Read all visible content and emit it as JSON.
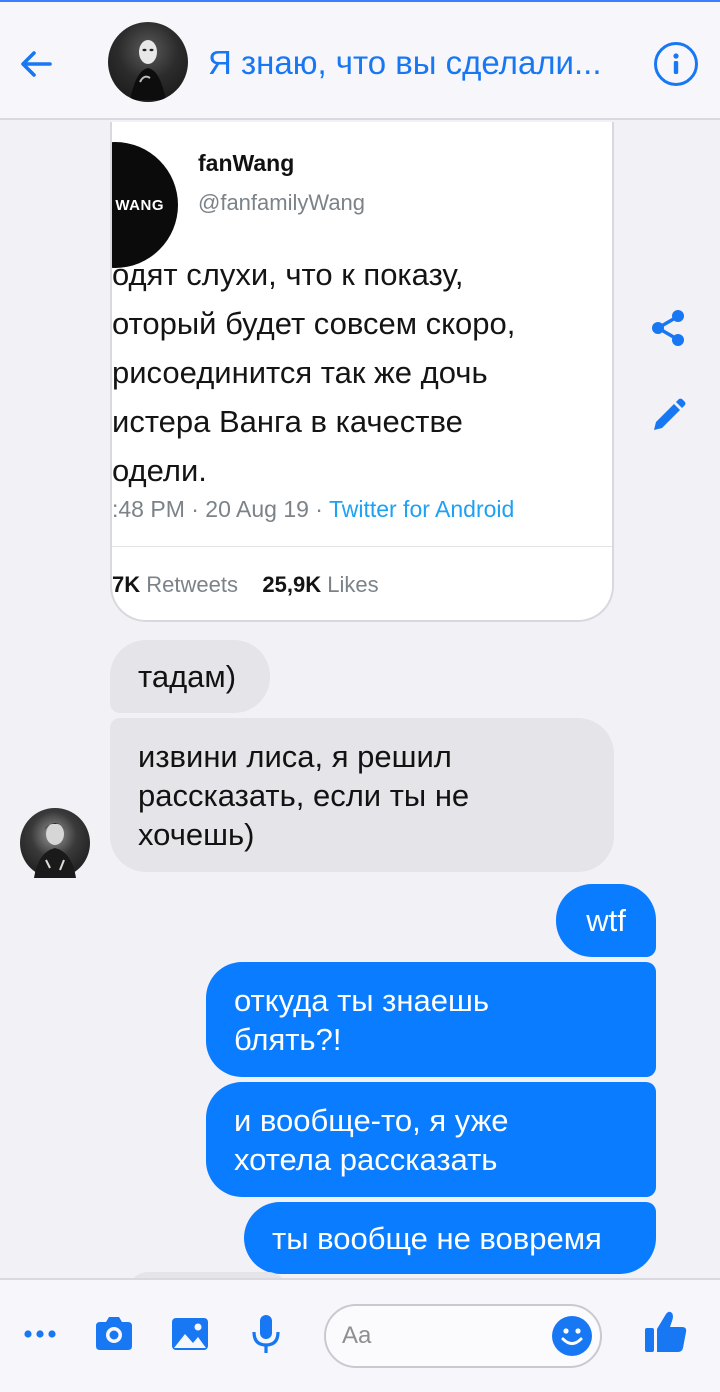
{
  "header": {
    "title": "Я знаю, что вы сделали..."
  },
  "tweet": {
    "avatar_text": "M WANG",
    "name": "fanWang",
    "handle": "@fanfamilyWang",
    "text": "одят слухи, что к показу,\nоторый будет совсем скоро,\nрисоединится так же дочь\nистера Ванга в качестве\nодели.",
    "time": ":48 PM · 20 Aug 19 · ",
    "source": "Twitter for Android",
    "retweets_count": "7K",
    "retweets_label": "Retweets",
    "likes_count": "25,9K",
    "likes_label": "Likes"
  },
  "messages": [
    {
      "side": "in",
      "text": "тадам)"
    },
    {
      "side": "in",
      "text": "извини лиса, я решил\nрассказать, если ты не\nхочешь)"
    },
    {
      "side": "out",
      "text": "wtf"
    },
    {
      "side": "out",
      "text": "откуда ты знаешь\nблять?!"
    },
    {
      "side": "out",
      "text": "и вообще-то, я уже\nхотела рассказать"
    },
    {
      "side": "out",
      "text": "ты вообще не вовремя"
    }
  ],
  "composer": {
    "placeholder": "Aa"
  },
  "icons": {
    "back": "arrow-left-icon",
    "info": "info-icon",
    "share": "share-icon",
    "edit": "pencil-icon",
    "more": "more-dots-icon",
    "camera": "camera-icon",
    "gallery": "image-icon",
    "mic": "microphone-icon",
    "emoji": "emoji-icon",
    "like": "thumbs-up-icon"
  },
  "colors": {
    "accent": "#1877f2",
    "outgoing_bubble": "#0a7cff",
    "incoming_bubble": "#e4e4e9",
    "link": "#1da1f2"
  }
}
